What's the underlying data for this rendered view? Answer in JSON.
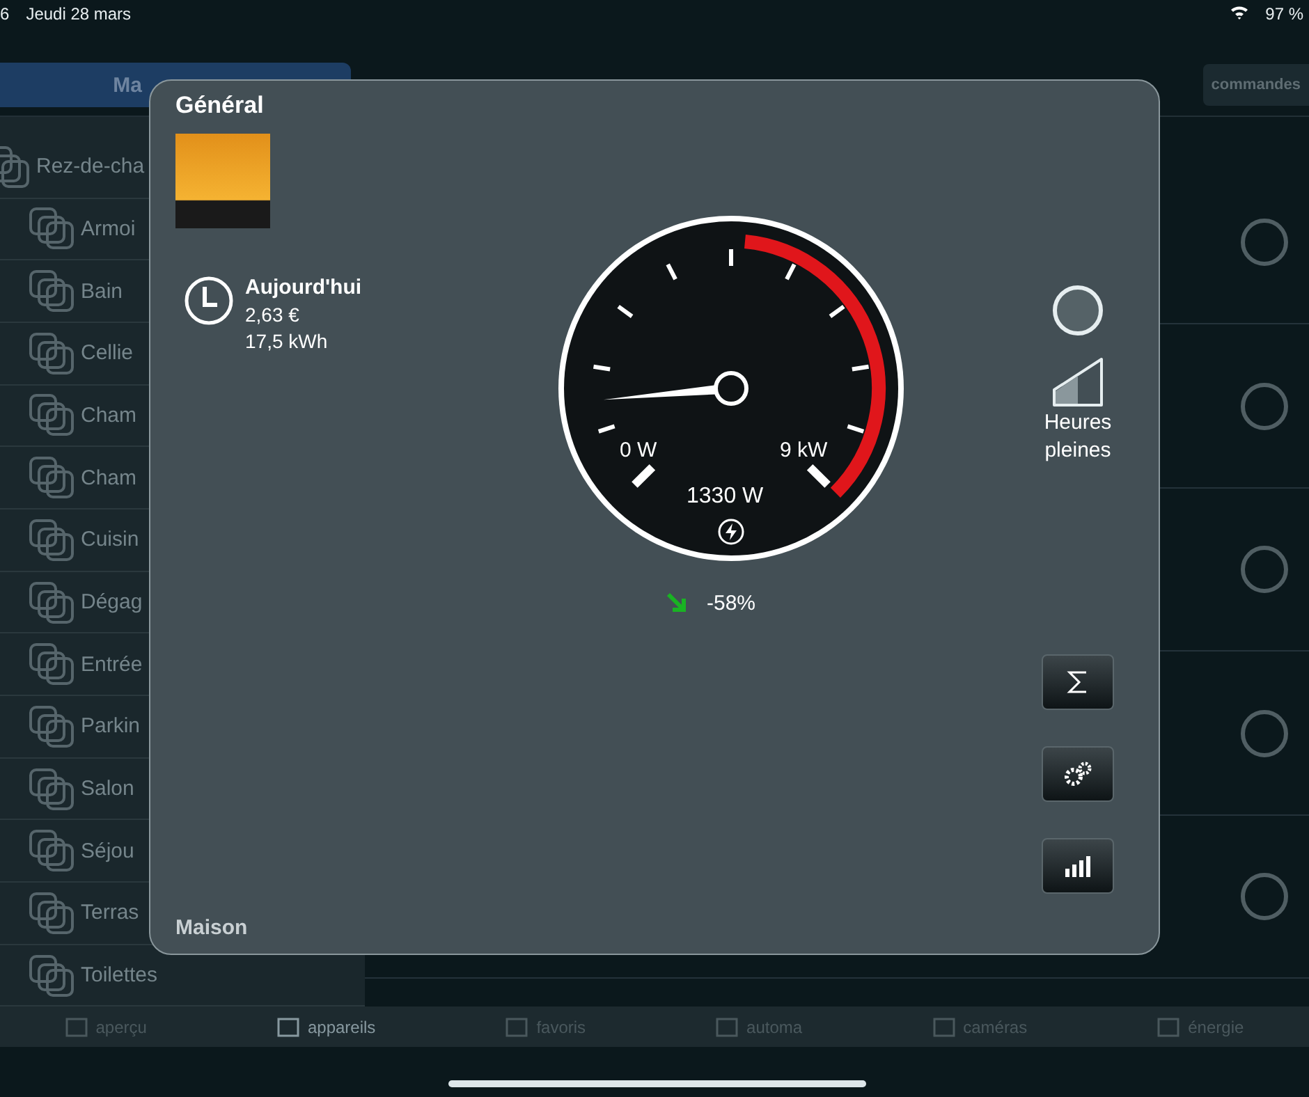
{
  "status_bar": {
    "time": "6",
    "date": "Jeudi 28 mars",
    "battery": "97 %"
  },
  "header": {
    "tabs": [
      {
        "label": "Ma",
        "selected": true
      }
    ],
    "commands_button": "commandes"
  },
  "sidebar": {
    "items": [
      {
        "label": "Rez-de-cha",
        "children": [
          {
            "label": "Armoi"
          },
          {
            "label": "Bain"
          },
          {
            "label": "Cellie"
          },
          {
            "label": "Cham"
          },
          {
            "label": "Cham"
          },
          {
            "label": "Cuisin"
          },
          {
            "label": "Dégag"
          },
          {
            "label": "Entrée"
          },
          {
            "label": "Parkin"
          },
          {
            "label": "Salon"
          },
          {
            "label": "Séjou"
          },
          {
            "label": "Terras"
          },
          {
            "label": "Toilettes"
          }
        ]
      }
    ]
  },
  "dialog": {
    "title": "Général",
    "today": {
      "label": "Aujourd'hui",
      "cost": "2,63 €",
      "energy": "17,5 kWh"
    },
    "gauge": {
      "level": 0.148,
      "min_label": "0 W",
      "max_label": "9 kW",
      "reading": "1330 W"
    },
    "trend": {
      "value": "-58%"
    },
    "tariff": {
      "label": "Heures pleines"
    },
    "footer": "Maison"
  },
  "tab_bar": [
    {
      "label": "aperçu",
      "selected": false
    },
    {
      "label": "appareils",
      "selected": true
    },
    {
      "label": "favoris",
      "selected": false
    },
    {
      "label": "automa",
      "selected": false
    },
    {
      "label": "caméras",
      "selected": false
    },
    {
      "label": "énergie",
      "selected": false
    }
  ]
}
